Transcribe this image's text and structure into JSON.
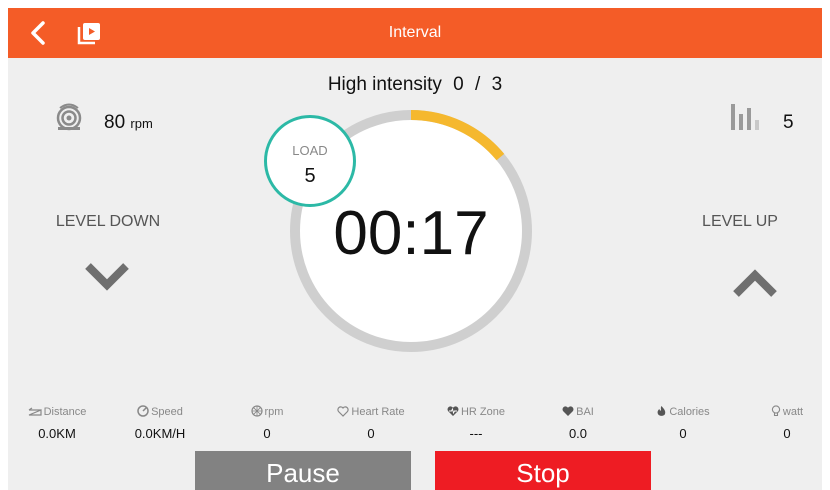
{
  "header": {
    "title": "Interval",
    "bg_color": "#f45c27",
    "back_icon": "chevron-left-icon",
    "video_icon": "video-playlist-icon"
  },
  "intensity": {
    "label": "High intensity",
    "current": "0",
    "separator": "/",
    "total": "3"
  },
  "cadence": {
    "icon": "rpm-sensor-icon",
    "value": "80",
    "unit": "rpm"
  },
  "level_indicator": {
    "icon": "level-bars-icon",
    "value": "5"
  },
  "level_down": {
    "label": "LEVEL DOWN",
    "icon": "chevron-down-icon"
  },
  "level_up": {
    "label": "LEVEL UP",
    "icon": "chevron-up-icon"
  },
  "timer": {
    "value": "00:17",
    "progress_fraction": 0.14,
    "progress_color": "#f5b82e",
    "track_color": "#cfcfcf"
  },
  "load": {
    "label": "LOAD",
    "value": "5",
    "ring_color": "#2cb9a6"
  },
  "metrics": [
    {
      "icon": "distance-icon",
      "label": "Distance",
      "value": "0.0KM"
    },
    {
      "icon": "speed-icon",
      "label": "Speed",
      "value": "0.0KM/H"
    },
    {
      "icon": "rpm-icon",
      "label": "rpm",
      "value": "0"
    },
    {
      "icon": "heart-outline-icon",
      "label": "Heart Rate",
      "value": "0"
    },
    {
      "icon": "heart-pulse-icon",
      "label": "HR Zone",
      "value": "---"
    },
    {
      "icon": "heart-solid-icon",
      "label": "BAI",
      "value": "0.0"
    },
    {
      "icon": "flame-icon",
      "label": "Calories",
      "value": "0"
    },
    {
      "icon": "bulb-icon",
      "label": "watt",
      "value": "0"
    }
  ],
  "actions": {
    "pause_label": "Pause",
    "pause_color": "#828282",
    "stop_label": "Stop",
    "stop_color": "#ee1c23"
  }
}
